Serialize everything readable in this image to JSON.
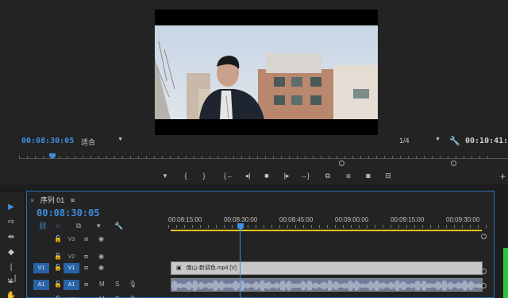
{
  "monitor": {
    "timecode": "00:08:30:05",
    "fit": "适合",
    "resolution": "1/4",
    "duration": "00:10:41:1",
    "transport": [
      "mark-in",
      "mark-out-brace-left",
      "mark-out-brace-right",
      "go-to-in",
      "step-back",
      "stop",
      "step-forward",
      "go-to-out",
      "insert",
      "overwrite",
      "export-frame",
      "comparison-view"
    ]
  },
  "timeline": {
    "tab_close": "×",
    "tab_title": "序列 01",
    "tab_menu": "≡",
    "timecode": "00:08:30:05",
    "ruler_labels": [
      "00:08:15:00",
      "00:08:30:00",
      "00:08:45:00",
      "00:09:00:00",
      "00:09:15:00",
      "00:09:30:00"
    ],
    "tracks": [
      {
        "src": "",
        "name": "V3",
        "type": "video"
      },
      {
        "src": "",
        "name": "V2",
        "type": "video"
      },
      {
        "src": "V1",
        "name": "V1",
        "type": "video"
      },
      {
        "src": "A1",
        "name": "A1",
        "type": "audio"
      },
      {
        "src": "",
        "name": "A2",
        "type": "audio"
      }
    ],
    "clip_video_label": "南山-新调色.mp4 [V]",
    "mute": "M",
    "solo": "S"
  },
  "colors": {
    "accent": "#3d8fe0",
    "playhead": "#3d8fe0",
    "work_area": "#e8c21b",
    "audio_clip": "#6e7c99",
    "video_clip": "#c8c8c8",
    "meter": "#2ec23b"
  }
}
